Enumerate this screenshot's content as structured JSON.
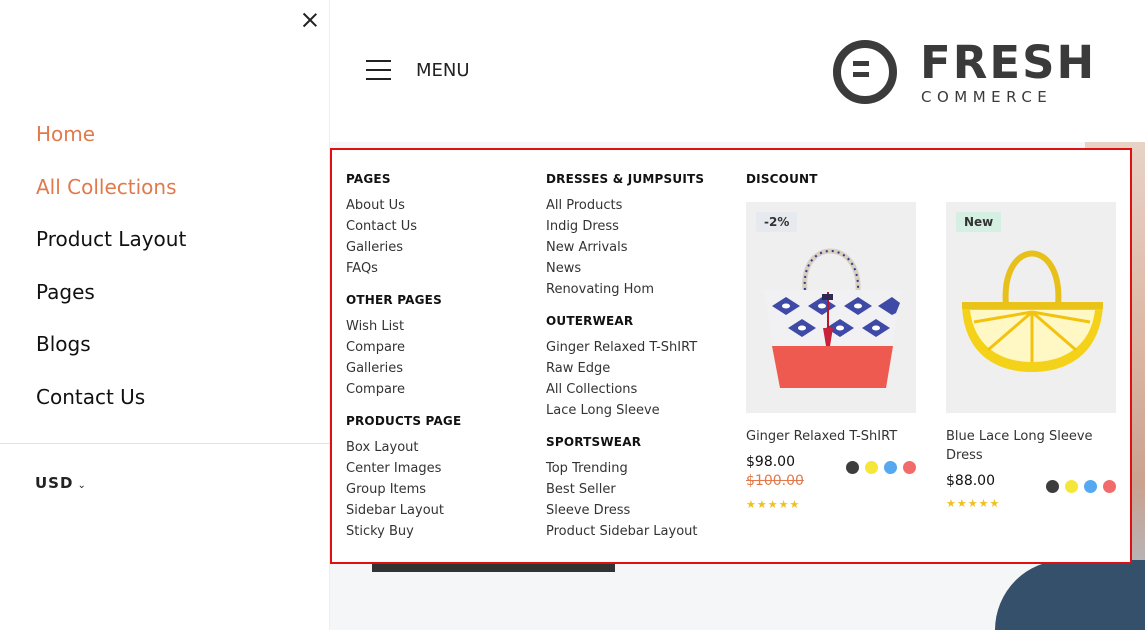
{
  "sidebar": {
    "nav": [
      {
        "label": "Home",
        "active": true
      },
      {
        "label": "All Collections",
        "active": true
      },
      {
        "label": "Product Layout",
        "active": false
      },
      {
        "label": "Pages",
        "active": false
      },
      {
        "label": "Blogs",
        "active": false
      },
      {
        "label": "Contact Us",
        "active": false
      }
    ],
    "currency": "USD"
  },
  "header": {
    "menu_label": "MENU",
    "logo_word": "FRESH",
    "logo_sub": "COMMERCE"
  },
  "mega_menu": {
    "col1": {
      "groups": [
        {
          "title": "PAGES",
          "links": [
            "About Us",
            "Contact Us",
            "Galleries",
            "FAQs"
          ]
        },
        {
          "title": "OTHER PAGES",
          "links": [
            "Wish List",
            "Compare",
            "Galleries",
            "Compare"
          ]
        },
        {
          "title": "PRODUCTS PAGE",
          "links": [
            "Box Layout",
            "Center Images",
            "Group Items",
            "Sidebar Layout",
            "Sticky Buy"
          ]
        }
      ]
    },
    "col2": {
      "groups": [
        {
          "title": "DRESSES & JUMPSUITS",
          "links": [
            "All Products",
            "Indig Dress",
            "New Arrivals",
            "News",
            "Renovating Hom"
          ]
        },
        {
          "title": "OUTERWEAR",
          "links": [
            "Ginger Relaxed T-ShIRT",
            "Raw Edge",
            "All Collections",
            "Lace Long Sleeve"
          ]
        },
        {
          "title": "SPORTSWEAR",
          "links": [
            "Top Trending",
            "Best Seller",
            "Sleeve Dress",
            "Product Sidebar Layout"
          ]
        }
      ]
    },
    "discount": {
      "title": "DISCOUNT",
      "products": [
        {
          "badge": "-2%",
          "name": "Ginger Relaxed T-ShIRT",
          "price": "$98.00",
          "old_price": "$100.00",
          "stars": "★★★★★",
          "rating": 5
        },
        {
          "badge": "New",
          "name": "Blue Lace Long Sleeve Dress",
          "price": "$88.00",
          "old_price": "",
          "stars": "★★★★★",
          "rating": 5
        }
      ],
      "swatch_colors": [
        "#3d3d3d",
        "#f5e63a",
        "#56a8f0",
        "#f26b6b"
      ]
    }
  },
  "colors": {
    "accent": "#e07a4c",
    "highlight_border": "#e01010",
    "star": "#f0c020"
  }
}
